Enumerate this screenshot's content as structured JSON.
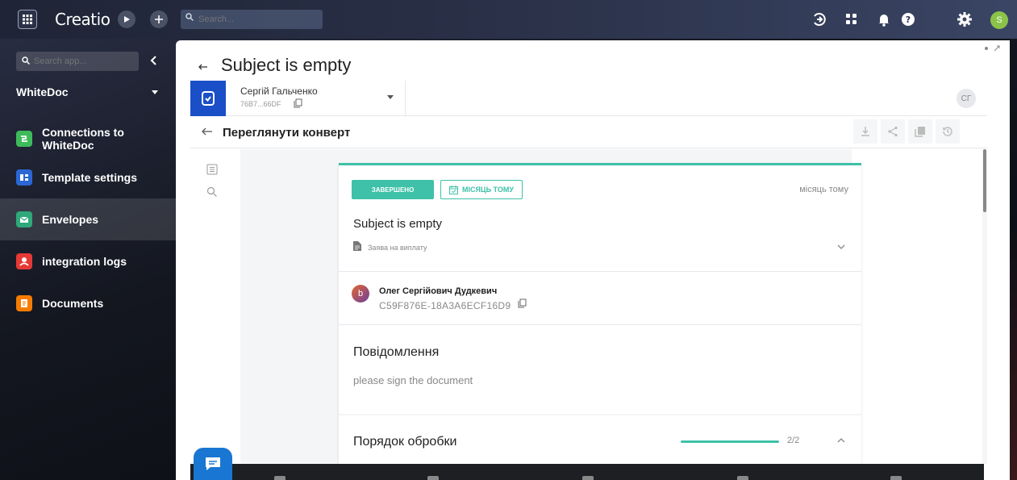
{
  "topbar": {
    "logo": "Creatio",
    "search_placeholder": "Search...",
    "user_initial": "S"
  },
  "sidebar": {
    "search_placeholder": "Search app...",
    "app_name": "WhiteDoc",
    "items": [
      {
        "label": "Connections to WhiteDoc",
        "color": "#3dbb5b",
        "icon": "link-icon"
      },
      {
        "label": "Template settings",
        "color": "#2a67d4",
        "icon": "template-icon"
      },
      {
        "label": "Envelopes",
        "color": "#2fa87a",
        "icon": "envelope-icon"
      },
      {
        "label": "integration logs",
        "color": "#e53935",
        "icon": "log-icon"
      },
      {
        "label": "Documents",
        "color": "#f57c00",
        "icon": "document-icon"
      }
    ],
    "active_index": 2
  },
  "panel": {
    "title": "Subject is empty",
    "user": {
      "name": "Сергій Гальченко",
      "id": "76B7...66DF",
      "initials": "СГ"
    },
    "envelope_title": "Переглянути конверт"
  },
  "card": {
    "status": "ЗАВЕРШЕНО",
    "date_badge": "МІСЯЦЬ ТОМУ",
    "time_ago": "місяць тому",
    "subject": "Subject is empty",
    "document_type": "Заява на виплату",
    "signer": {
      "initial": "b",
      "name": "Олег Сергійович Дудкевич",
      "id": "C59F876E-18A3A6ECF16D9"
    },
    "message_title": "Повідомлення",
    "message_body": "please sign the document",
    "process_title": "Порядок обробки",
    "process_progress": 1.0,
    "process_count": "2/2"
  },
  "colors": {
    "accent": "#3ec1a8",
    "brand_blue": "#1a4fc7",
    "chat_blue": "#1976d2"
  }
}
